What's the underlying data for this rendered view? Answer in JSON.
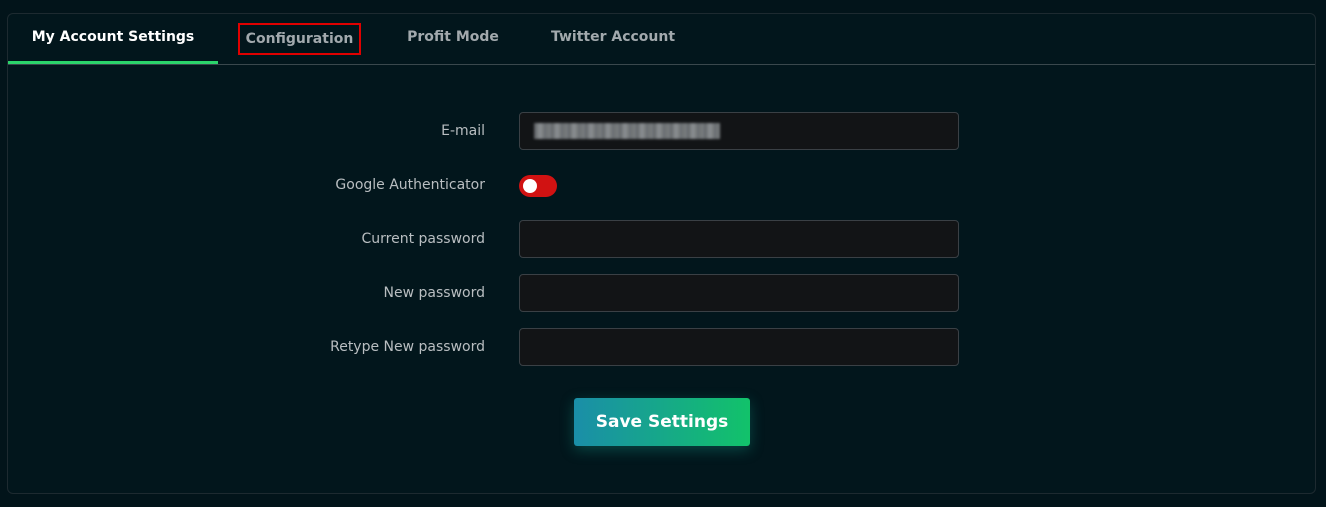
{
  "tabs": [
    {
      "label": "My Account Settings",
      "active": true
    },
    {
      "label": "Configuration",
      "active": false,
      "highlighted": true
    },
    {
      "label": "Profit Mode",
      "active": false
    },
    {
      "label": "Twitter Account",
      "active": false
    }
  ],
  "form": {
    "email_label": "E-mail",
    "email_value": "redacted",
    "google_auth_label": "Google Authenticator",
    "google_auth_enabled": false,
    "current_password_label": "Current password",
    "new_password_label": "New password",
    "retype_password_label": "Retype New password",
    "save_label": "Save Settings"
  },
  "colors": {
    "accent": "#2bd46b",
    "highlight_box": "#e00000",
    "toggle_off": "#d11212"
  }
}
